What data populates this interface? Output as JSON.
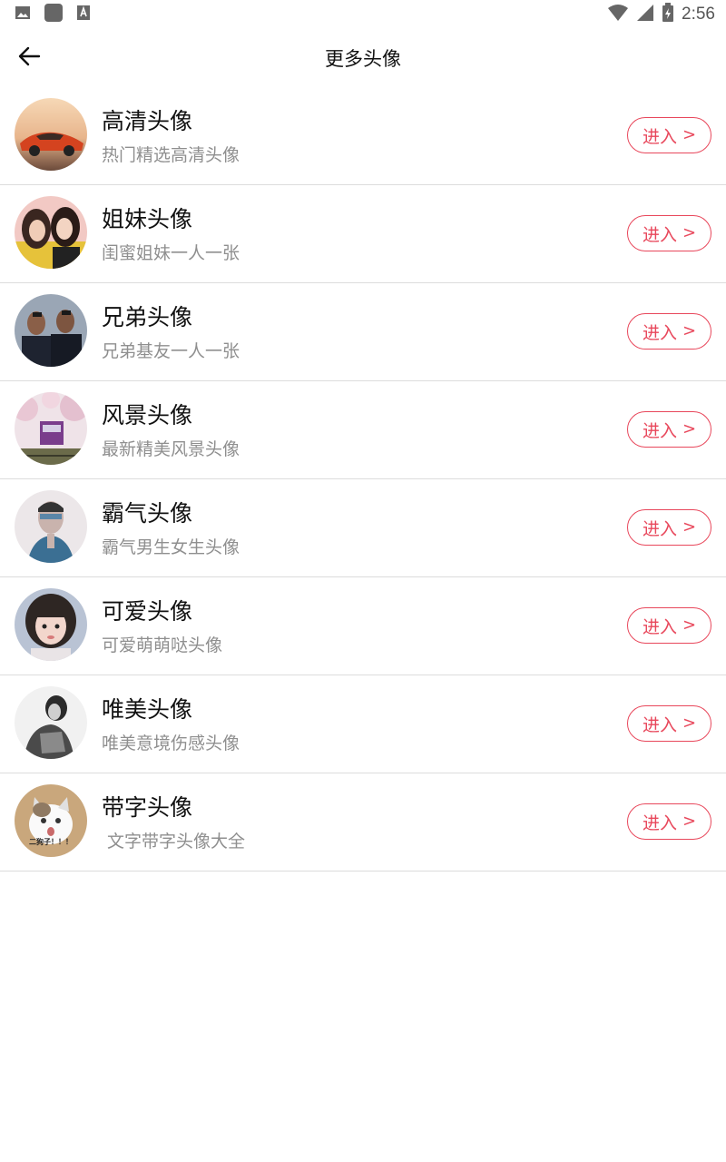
{
  "status_bar": {
    "time": "2:56",
    "icons": [
      "image-icon",
      "app-square-icon",
      "font-a-icon",
      "wifi-icon",
      "cell-signal-icon",
      "battery-charging-icon"
    ]
  },
  "toolbar": {
    "title": "更多头像",
    "back_icon": "arrow-left-icon"
  },
  "colors": {
    "accent": "#e8475b",
    "title_text": "#111111",
    "subtitle_text": "#8f8f8f",
    "divider": "#dcdcdc"
  },
  "categories": [
    {
      "title": "高清头像",
      "subtitle": "热门精选高清头像",
      "button": "进入",
      "avatar": "sports-car-avatar"
    },
    {
      "title": "姐妹头像",
      "subtitle": "闺蜜姐妹一人一张",
      "button": "进入",
      "avatar": "two-girls-avatar"
    },
    {
      "title": "兄弟头像",
      "subtitle": "兄弟基友一人一张",
      "button": "进入",
      "avatar": "two-men-avatar"
    },
    {
      "title": "风景头像",
      "subtitle": "最新精美风景头像",
      "button": "进入",
      "avatar": "cherry-blossom-train-avatar"
    },
    {
      "title": "霸气头像",
      "subtitle": "霸气男生女生头像",
      "button": "进入",
      "avatar": "cool-man-avatar"
    },
    {
      "title": "可爱头像",
      "subtitle": "可爱萌萌哒头像",
      "button": "进入",
      "avatar": "cute-girl-avatar"
    },
    {
      "title": "唯美头像",
      "subtitle": "唯美意境伤感头像",
      "button": "进入",
      "avatar": "monochrome-girl-avatar"
    },
    {
      "title": "带字头像",
      "subtitle": " 文字带字头像大全",
      "button": "进入",
      "avatar": "cat-with-text-avatar",
      "avatar_caption": "二狗子！！！"
    }
  ]
}
